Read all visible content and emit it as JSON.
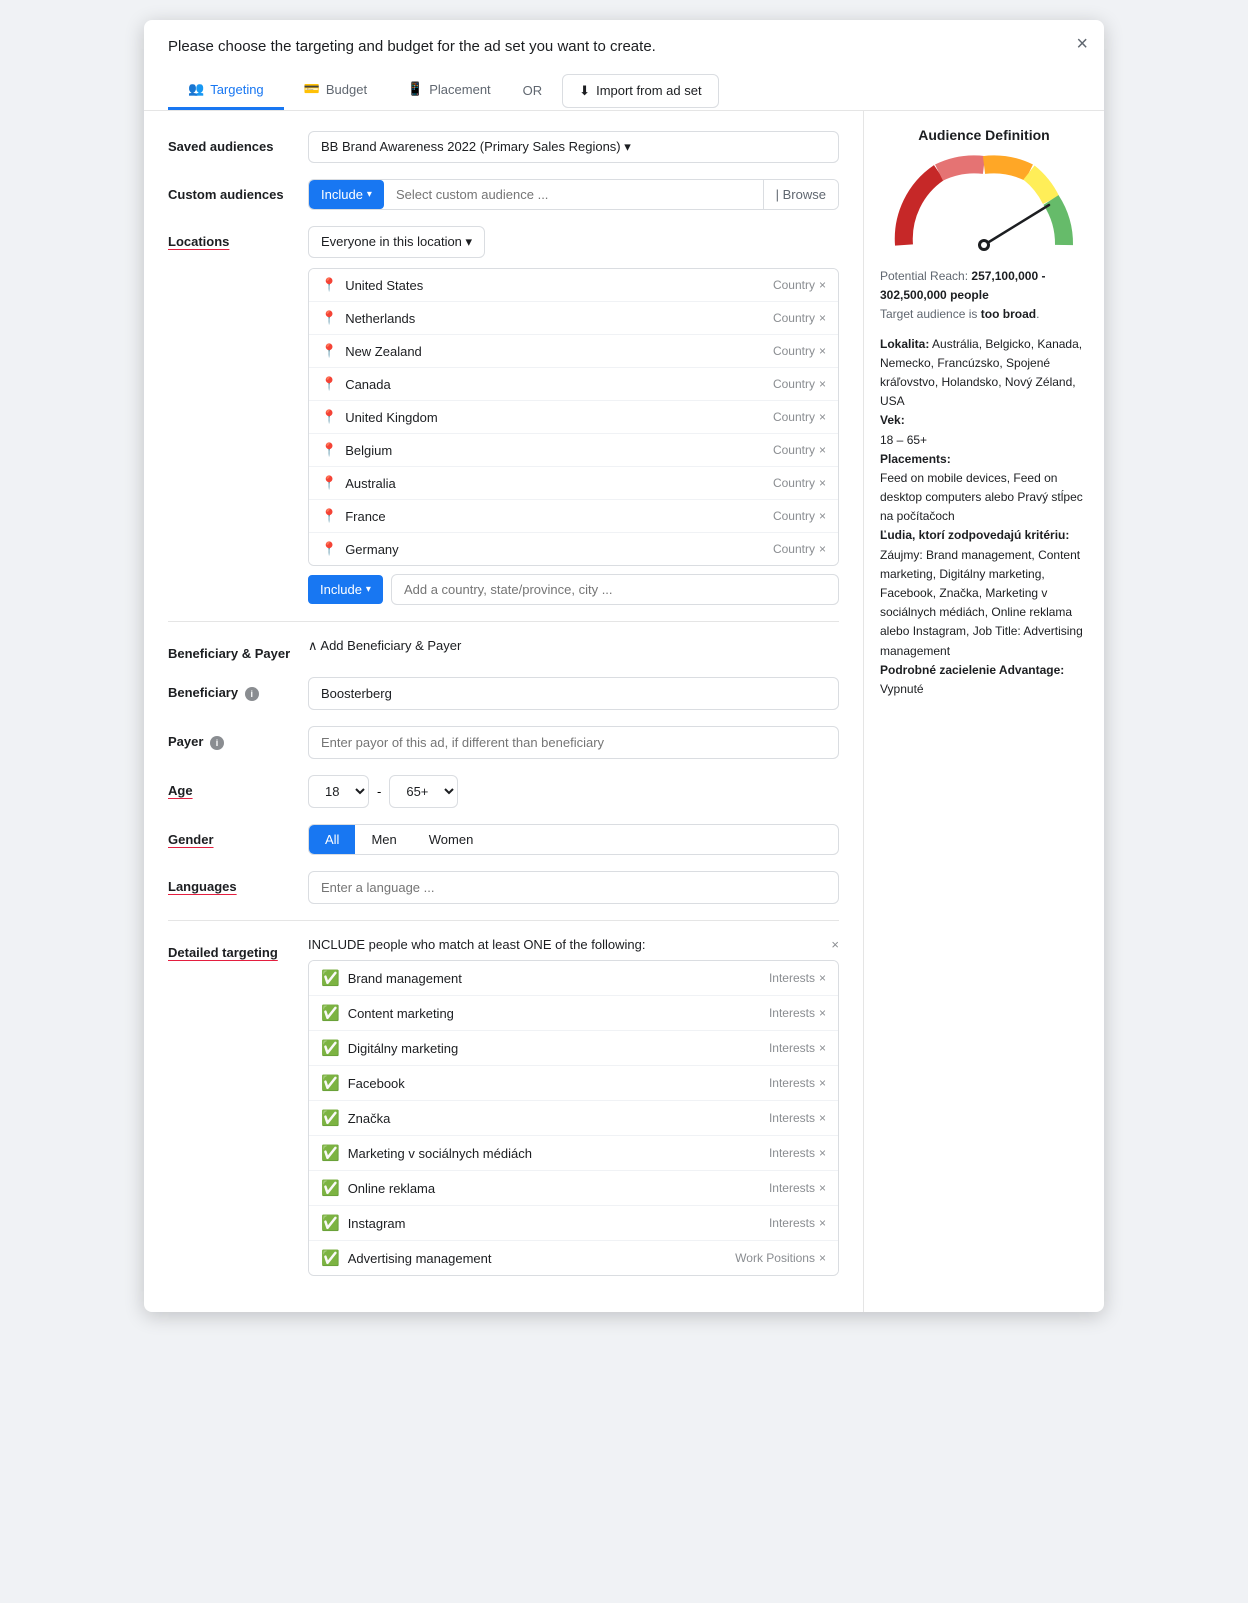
{
  "modal": {
    "title": "Please choose the targeting and budget for the ad set you want to create.",
    "close_label": "×"
  },
  "tabs": [
    {
      "id": "targeting",
      "label": "Targeting",
      "icon": "👥",
      "active": true
    },
    {
      "id": "budget",
      "label": "Budget",
      "icon": "💳",
      "active": false
    },
    {
      "id": "placement",
      "label": "Placement",
      "icon": "📱",
      "active": false
    }
  ],
  "tab_or": "OR",
  "import_btn": "Import from ad set",
  "form": {
    "saved_audiences_label": "Saved audiences",
    "saved_audiences_value": "BB Brand Awareness 2022 (Primary Sales Regions) ▾",
    "custom_audiences_label": "Custom audiences",
    "include_label": "Include",
    "select_custom_placeholder": "Select custom audience ...",
    "browse_label": "Browse",
    "locations_label": "Locations",
    "everyone_label": "Everyone in this location ▾",
    "countries": [
      {
        "name": "United States",
        "type": "Country"
      },
      {
        "name": "Netherlands",
        "type": "Country"
      },
      {
        "name": "New Zealand",
        "type": "Country"
      },
      {
        "name": "Canada",
        "type": "Country"
      },
      {
        "name": "United Kingdom",
        "type": "Country"
      },
      {
        "name": "Belgium",
        "type": "Country"
      },
      {
        "name": "Australia",
        "type": "Country"
      },
      {
        "name": "France",
        "type": "Country"
      },
      {
        "name": "Germany",
        "type": "Country"
      }
    ],
    "add_location_include_label": "Include",
    "add_location_placeholder": "Add a country, state/province, city ...",
    "beneficiary_payer_label": "Beneficiary & Payer",
    "add_beneficiary_payer": "∧ Add Beneficiary & Payer",
    "beneficiary_label": "Beneficiary",
    "beneficiary_value": "Boosterberg",
    "payer_label": "Payer",
    "payer_placeholder": "Enter payor of this ad, if different than beneficiary",
    "age_label": "Age",
    "age_from": "18 ▾",
    "age_dash": "-",
    "age_to": "65+ ▾",
    "gender_label": "Gender",
    "gender_options": [
      "All",
      "Men",
      "Women"
    ],
    "gender_active": "All",
    "languages_label": "Languages",
    "languages_placeholder": "Enter a language ...",
    "detailed_targeting_label": "Detailed targeting",
    "detailed_include_text": "INCLUDE people who match at least ONE of the following:",
    "interests": [
      {
        "name": "Brand management",
        "type": "Interests"
      },
      {
        "name": "Content marketing",
        "type": "Interests"
      },
      {
        "name": "Digitálny marketing",
        "type": "Interests"
      },
      {
        "name": "Facebook",
        "type": "Interests"
      },
      {
        "name": "Značka",
        "type": "Interests"
      },
      {
        "name": "Marketing v sociálnych médiách",
        "type": "Interests"
      },
      {
        "name": "Online reklama",
        "type": "Interests"
      },
      {
        "name": "Instagram",
        "type": "Interests"
      },
      {
        "name": "Advertising management",
        "type": "Work Positions"
      }
    ]
  },
  "audience": {
    "title": "Audience Definition",
    "potential_reach_label": "Potential Reach:",
    "potential_reach_value": "257,100,000 - 302,500,000 people",
    "target_audience_label": "Target audience is",
    "target_audience_status": "too broad",
    "lokalita_label": "Lokalita:",
    "lokalita_value": "Austrália, Belgicko, Kanada, Nemecko, Francúzsko, Spojené kráľovstvo, Holandsko, Nový Zéland, USA",
    "vek_label": "Vek:",
    "vek_value": "18 – 65+",
    "placements_label": "Placements:",
    "placements_value": "Feed on mobile devices, Feed on desktop computers alebo Pravý stĺpec na počítačoch",
    "ludia_label": "Ľudia, ktorí zodpovedajú kritériu:",
    "ludia_value": "Záujmy: Brand management, Content marketing, Digitálny marketing, Facebook, Značka, Marketing v sociálnych médiách, Online reklama alebo Instagram, Job Title: Advertising management",
    "podrobne_label": "Podrobné zacielenie Advantage:",
    "podrobne_value": "Vypnuté",
    "gauge": {
      "segments": [
        {
          "color": "#d32f2f",
          "start": 180,
          "end": 240
        },
        {
          "color": "#e57373",
          "start": 240,
          "end": 280
        },
        {
          "color": "#ffa726",
          "start": 280,
          "end": 310
        },
        {
          "color": "#ffee58",
          "start": 310,
          "end": 330
        },
        {
          "color": "#66bb6a",
          "start": 330,
          "end": 360
        }
      ],
      "needle_angle": 335
    }
  }
}
